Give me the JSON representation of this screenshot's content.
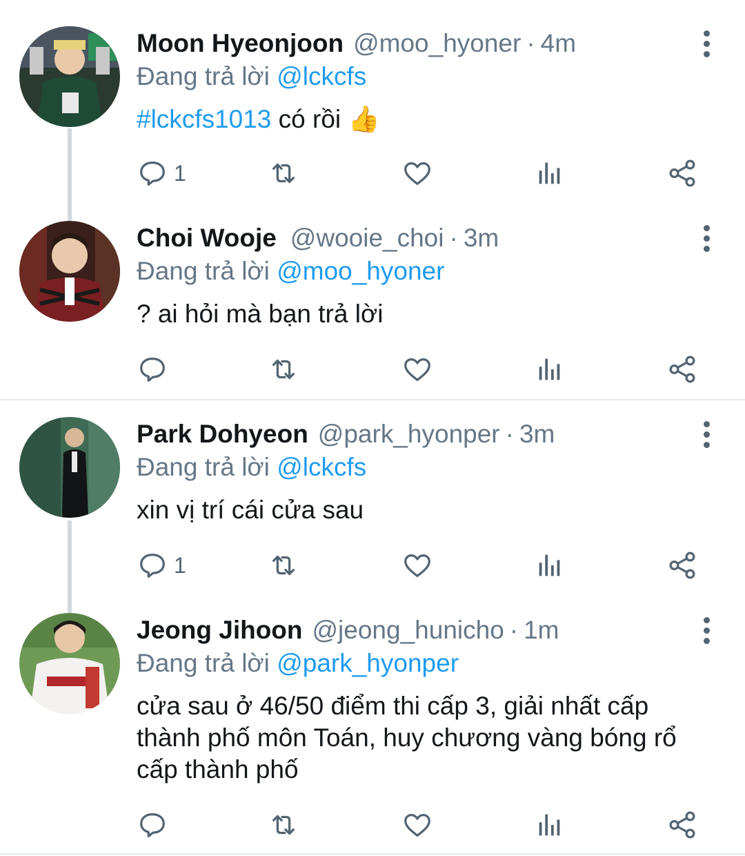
{
  "tweets": [
    {
      "name": "Moon Hyeonjoon",
      "handle": "@moo_hyoner",
      "time": "4m",
      "replying_prefix": "Đang trả lời",
      "replying_to": "@lckcfs",
      "hashtag": "#lckcfs1013",
      "text": "có rồi",
      "emoji": "👍",
      "reply_count": "1"
    },
    {
      "name": "Choi Wooje",
      "handle": "@wooie_choi",
      "time": "3m",
      "replying_prefix": "Đang trả lời",
      "replying_to": "@moo_hyoner",
      "text": "? ai hỏi mà bạn trả lời",
      "reply_count": ""
    },
    {
      "name": "Park Dohyeon",
      "handle": "@park_hyonper",
      "time": "3m",
      "replying_prefix": "Đang trả lời",
      "replying_to": "@lckcfs",
      "text": "xin vị trí cái cửa sau",
      "reply_count": "1"
    },
    {
      "name": "Jeong Jihoon",
      "handle": "@jeong_hunicho",
      "time": "1m",
      "replying_prefix": "Đang trả lời",
      "replying_to": "@park_hyonper",
      "text": "cửa sau ở 46/50 điểm thi cấp 3, giải nhất cấp thành phố môn Toán, huy chương vàng bóng rổ cấp thành phố",
      "reply_count": ""
    }
  ],
  "colors": {
    "link": "#1d9bf0",
    "muted": "#657786",
    "icon": "#536471",
    "thread": "#cfd9de"
  },
  "icons": [
    "reply-icon",
    "retweet-icon",
    "like-icon",
    "views-icon",
    "share-icon",
    "more-icon"
  ]
}
